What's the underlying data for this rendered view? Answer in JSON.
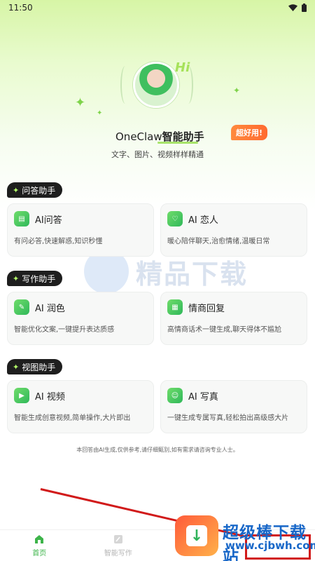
{
  "status_bar": {
    "time": "11:50"
  },
  "hero": {
    "greeting": "Hi",
    "title_prefix": "OneClaw",
    "title_suffix": "智能助手",
    "badge": "超好用!",
    "subtitle": "文字、图片、视频样样精通"
  },
  "sections": [
    {
      "tag": "问答助手",
      "cards": [
        {
          "title": "AI问答",
          "desc": "有问必答,快速解惑,知识秒懂",
          "icon": "chat-icon"
        },
        {
          "title": "AI 恋人",
          "desc": "暖心陪伴聊天,治愈情绪,温暖日常",
          "icon": "lover-icon"
        }
      ]
    },
    {
      "tag": "写作助手",
      "cards": [
        {
          "title": "AI 润色",
          "desc": "智能优化文案,一键提升表达质感",
          "icon": "pen-icon"
        },
        {
          "title": "情商回复",
          "desc": "高情商话术一键生成,聊天得体不尴尬",
          "icon": "reply-icon"
        }
      ]
    },
    {
      "tag": "视图助手",
      "cards": [
        {
          "title": "AI 视频",
          "desc": "智能生成创意视频,简单操作,大片即出",
          "icon": "video-icon"
        },
        {
          "title": "AI 写真",
          "desc": "一键生成专属写真,轻松拍出高级感大片",
          "icon": "portrait-icon"
        }
      ]
    }
  ],
  "disclaimer": "本回答由AI生成,仅供参考,请仔细甄别,如有需求请咨询专业人士。",
  "bottom_nav": [
    {
      "label": "首页",
      "icon": "home-icon",
      "active": true
    },
    {
      "label": "智能写作",
      "icon": "write-icon",
      "active": false
    },
    {
      "label": "",
      "icon": "",
      "active": false
    },
    {
      "label": "",
      "icon": "",
      "active": false
    }
  ],
  "watermark": {
    "text": "精品下载"
  },
  "promo": {
    "name": "超级棒下载站",
    "url": "www.cjbwh.com"
  },
  "colors": {
    "accent": "#3db44a",
    "badge": "#ff7a35",
    "tag_bg": "#1e1e1e",
    "annotation_red": "#d11a1a"
  }
}
